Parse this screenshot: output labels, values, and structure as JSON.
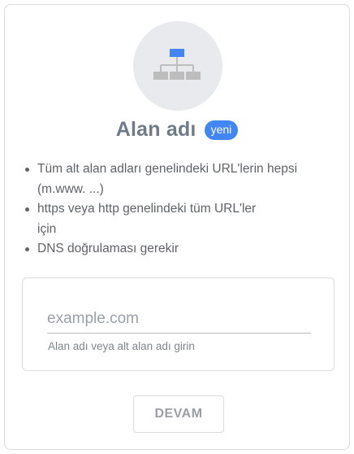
{
  "card": {
    "icon": "domain-sitemap-icon",
    "title": "Alan adı",
    "badge": "yeni",
    "bullets": [
      "Tüm alt alan adları genelindeki URL'lerin hepsi (m.www. ...)",
      "https veya http genelindeki tüm URL'ler için",
      "DNS doğrulaması gerekir"
    ],
    "input": {
      "value": "",
      "placeholder": "example.com",
      "hint": "Alan adı veya alt alan adı girin"
    },
    "continue_label": "DEVAM"
  },
  "colors": {
    "accent": "#4285f4",
    "title": "#6f7c88",
    "icon_background": "#e8eaed",
    "icon_grey": "#bdbdbd"
  }
}
